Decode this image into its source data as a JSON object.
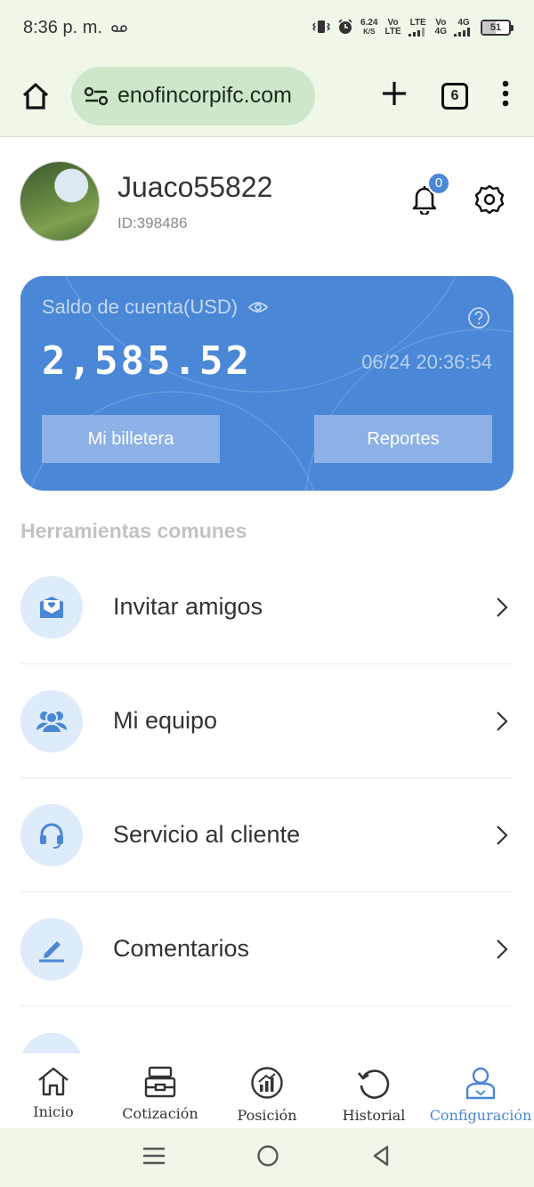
{
  "status_bar": {
    "time": "8:36 p. m.",
    "net_speed_value": "6.24",
    "net_speed_unit": "K/S",
    "sim1_top": "Vo",
    "sim1_bottom": "LTE",
    "sim1_type": "LTE",
    "sim2_top": "Vo",
    "sim2_bottom": "4G",
    "sim2_type": "4G",
    "battery": "51"
  },
  "browser": {
    "url": "enofincorpifc.com",
    "tab_count": "6"
  },
  "profile": {
    "username": "Juaco55822",
    "user_id": "ID:398486",
    "notification_count": "0"
  },
  "balance_card": {
    "label": "Saldo de cuenta(USD)",
    "amount": "2,585.52",
    "timestamp": "06/24 20:36:54",
    "wallet_button": "Mi billetera",
    "reports_button": "Reportes",
    "accent_color": "#4a87d6"
  },
  "tools": {
    "title": "Herramientas comunes",
    "items": [
      {
        "label": "Invitar amigos",
        "icon": "envelope-heart-icon"
      },
      {
        "label": "Mi equipo",
        "icon": "team-icon"
      },
      {
        "label": "Servicio al cliente",
        "icon": "headset-icon"
      },
      {
        "label": "Comentarios",
        "icon": "pencil-icon"
      }
    ]
  },
  "bottom_nav": {
    "items": [
      {
        "label": "Inicio",
        "icon": "home-icon"
      },
      {
        "label": "Cotización",
        "icon": "inbox-icon"
      },
      {
        "label": "Posición",
        "icon": "chart-growth-icon"
      },
      {
        "label": "Historial",
        "icon": "history-icon"
      },
      {
        "label": "Configuración",
        "icon": "user-icon"
      }
    ],
    "active_index": 4
  }
}
